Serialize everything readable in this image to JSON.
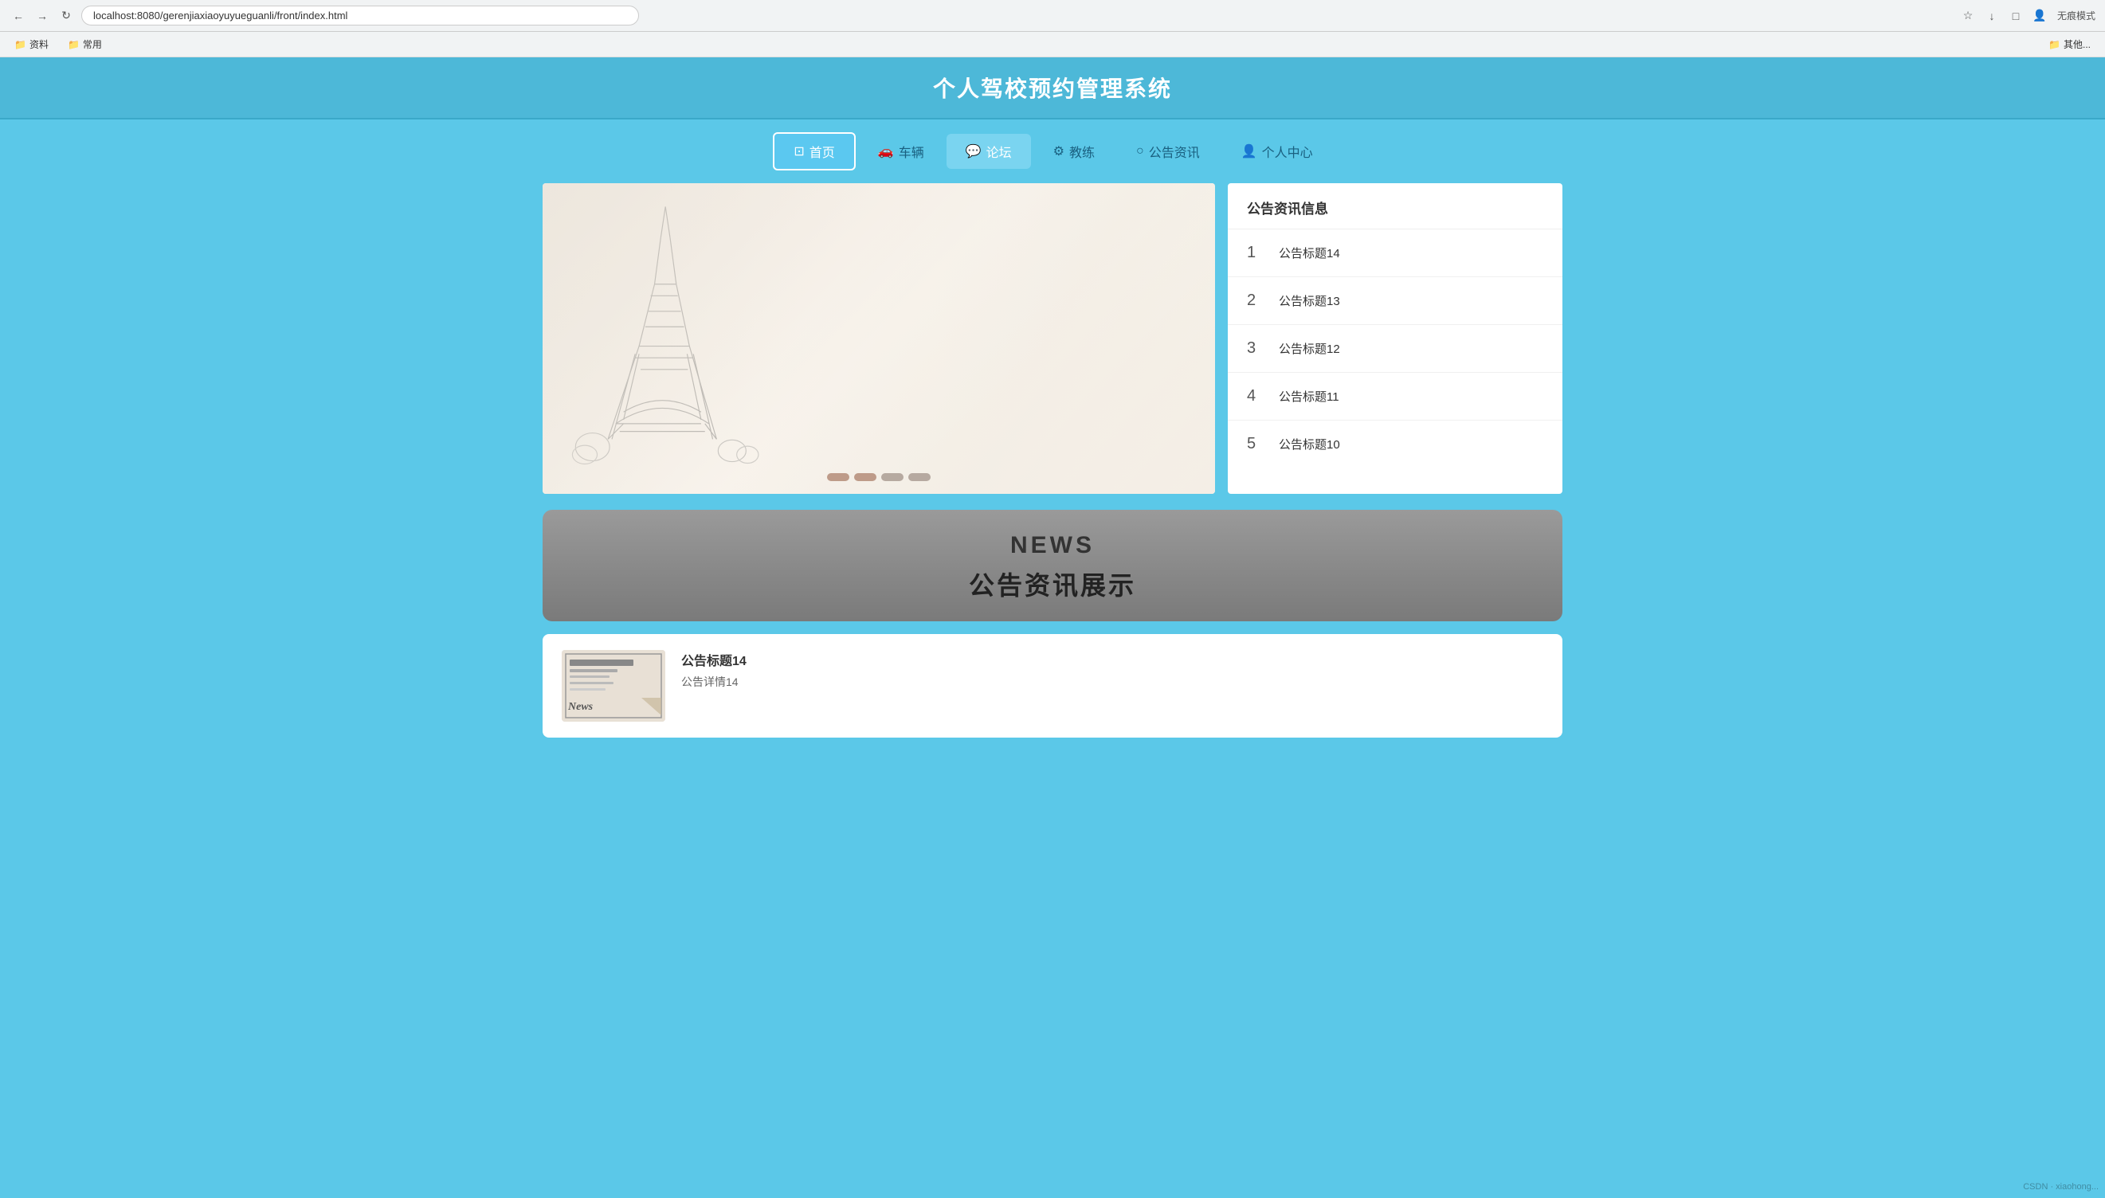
{
  "browser": {
    "url": "localhost:8080/gerenjiaxiaoyuyueguanli/front/index.html",
    "back_label": "←",
    "forward_label": "→",
    "reload_label": "↻",
    "bookmark_icon": "★",
    "download_icon": "↓",
    "extend_icon": "⬜",
    "profile_icon": "👤",
    "mode_label": "无痕模式"
  },
  "bookmarks": {
    "items": [
      {
        "label": "资料",
        "icon": "📁"
      },
      {
        "label": "常用",
        "icon": "📁"
      },
      {
        "label": "其他...",
        "icon": "📁"
      }
    ]
  },
  "header": {
    "title": "个人驾校预约管理系统"
  },
  "nav": {
    "items": [
      {
        "id": "home",
        "icon": "⊡",
        "label": "首页",
        "active": true
      },
      {
        "id": "vehicle",
        "icon": "🚗",
        "label": "车辆",
        "active": false
      },
      {
        "id": "forum",
        "icon": "💬",
        "label": "论坛",
        "active": true
      },
      {
        "id": "coach",
        "icon": "👨‍🏫",
        "label": "教练",
        "active": false
      },
      {
        "id": "news",
        "icon": "○",
        "label": "公告资讯",
        "active": false
      },
      {
        "id": "profile",
        "icon": "👤",
        "label": "个人中心",
        "active": false
      }
    ]
  },
  "announcement_panel": {
    "header": "公告资讯信息",
    "items": [
      {
        "num": "1",
        "title": "公告标题14"
      },
      {
        "num": "2",
        "title": "公告标题13"
      },
      {
        "num": "3",
        "title": "公告标题12"
      },
      {
        "num": "4",
        "title": "公告标题11"
      },
      {
        "num": "5",
        "title": "公告标题10"
      }
    ]
  },
  "carousel": {
    "indicators": [
      {
        "active": true
      },
      {
        "active": true
      },
      {
        "active": false
      },
      {
        "active": false
      }
    ]
  },
  "news_section": {
    "en_title": "NEWS",
    "zh_title": "公告资讯展示"
  },
  "news_card": {
    "title": "公告标题14",
    "description": "公告详情14"
  }
}
